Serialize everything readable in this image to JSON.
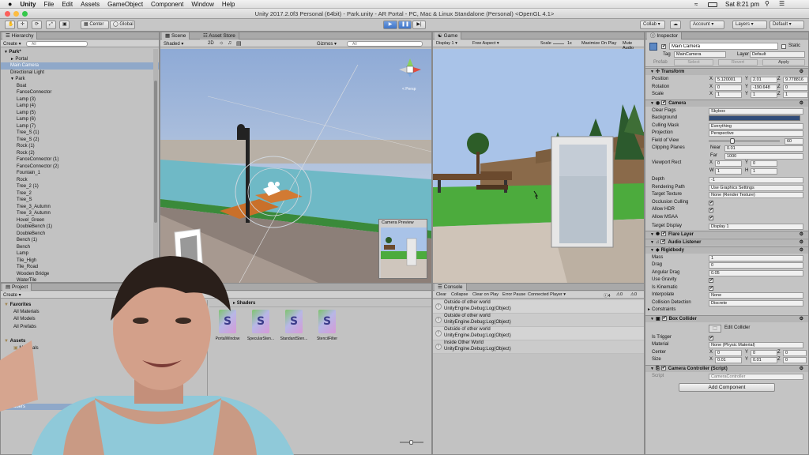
{
  "menubar": {
    "apple": "",
    "app": "Unity",
    "items": [
      "File",
      "Edit",
      "Assets",
      "GameObject",
      "Component",
      "Window",
      "Help"
    ],
    "clock": "Sat 8:21 pm"
  },
  "window": {
    "title": "Unity 2017.2.0f3 Personal (64bit) - Park.unity - AR Portal - PC, Mac & Linux Standalone (Personal) <OpenGL 4.1>"
  },
  "toolbar": {
    "pivot": "Center",
    "space": "Global",
    "collab": "Collab",
    "account": "Account",
    "layers": "Layers",
    "layout": "Default"
  },
  "hierarchy": {
    "tab": "Hierarchy",
    "create": "Create",
    "search_placeholder": "All",
    "rows": [
      {
        "label": "Park*",
        "indent": 0,
        "arrow": "▼",
        "bold": true
      },
      {
        "label": "Portal",
        "indent": 1,
        "arrow": "►"
      },
      {
        "label": "Main Camera",
        "indent": 1,
        "selected": true
      },
      {
        "label": "Directional Light",
        "indent": 1
      },
      {
        "label": "Park",
        "indent": 1,
        "arrow": "▼"
      },
      {
        "label": "Boat",
        "indent": 2
      },
      {
        "label": "FanceConnector",
        "indent": 2
      },
      {
        "label": "Lamp (3)",
        "indent": 2
      },
      {
        "label": "Lamp (4)",
        "indent": 2
      },
      {
        "label": "Lamp (5)",
        "indent": 2
      },
      {
        "label": "Lamp (6)",
        "indent": 2
      },
      {
        "label": "Lamp (7)",
        "indent": 2
      },
      {
        "label": "Tree_S (1)",
        "indent": 2
      },
      {
        "label": "Tree_S (2)",
        "indent": 2
      },
      {
        "label": "Rock (1)",
        "indent": 2
      },
      {
        "label": "Rock (2)",
        "indent": 2
      },
      {
        "label": "FanceConnector (1)",
        "indent": 2
      },
      {
        "label": "FanceConnector (2)",
        "indent": 2
      },
      {
        "label": "Fountain_1",
        "indent": 2
      },
      {
        "label": "Rock",
        "indent": 2
      },
      {
        "label": "Tree_2 (1)",
        "indent": 2
      },
      {
        "label": "Tree_2",
        "indent": 2
      },
      {
        "label": "Tree_S",
        "indent": 2
      },
      {
        "label": "Tree_3_Autumn",
        "indent": 2
      },
      {
        "label": "Tree_3_Autumn",
        "indent": 2
      },
      {
        "label": "Hovel_Green",
        "indent": 2
      },
      {
        "label": "DoubleBench (1)",
        "indent": 2
      },
      {
        "label": "DoubleBench",
        "indent": 2
      },
      {
        "label": "Bench (1)",
        "indent": 2
      },
      {
        "label": "Bench",
        "indent": 2
      },
      {
        "label": "Lamp",
        "indent": 2
      },
      {
        "label": "Tile_High",
        "indent": 2
      },
      {
        "label": "Tile_Road",
        "indent": 2
      },
      {
        "label": "Wooden Bridge",
        "indent": 2
      },
      {
        "label": "WaterTile",
        "indent": 2
      }
    ]
  },
  "scene": {
    "tabs": [
      "Scene",
      "Asset Store"
    ],
    "shading": "Shaded",
    "mode2d": "2D",
    "gizmos": "Gizmos",
    "search": "All",
    "persp": "< Persp",
    "preview_title": "Camera Preview"
  },
  "game": {
    "tab": "Game",
    "display": "Display 1",
    "aspect": "Free Aspect",
    "scale_label": "Scale",
    "scale_value": "1x",
    "maximize": "Maximize On Play",
    "mute": "Mute Audio"
  },
  "project": {
    "tab": "Project",
    "create": "Create",
    "breadcrumb": "Shaders",
    "tree": [
      {
        "label": "Favorites",
        "indent": 0,
        "folder": true,
        "bold": true
      },
      {
        "label": "All Materials",
        "indent": 1
      },
      {
        "label": "All Models",
        "indent": 1
      },
      {
        "label": "All Prefabs",
        "indent": 1
      },
      {
        "label": "",
        "indent": 0
      },
      {
        "label": "Assets",
        "indent": 0,
        "folder": true,
        "bold": true
      },
      {
        "label": "Materials",
        "indent": 1,
        "folder": true
      },
      {
        "label": "Materials",
        "indent": 1
      },
      {
        "label": "odels",
        "indent": 1
      },
      {
        "label": "efabs",
        "indent": 1
      },
      {
        "label": "xtures",
        "indent": 1
      },
      {
        "label": "nts",
        "indent": 1
      },
      {
        "label": "es",
        "indent": 1
      },
      {
        "label": "ts",
        "indent": 1
      },
      {
        "label": "aders",
        "indent": 1,
        "selected": true
      }
    ],
    "files": [
      "PortalWindow",
      "SpecularSten...",
      "StandardSten...",
      "StencilFilter"
    ]
  },
  "console": {
    "tab": "Console",
    "buttons": [
      "Clear",
      "Collapse",
      "Clear on Play",
      "Error Pause",
      "Connected Player ▾"
    ],
    "count_log": "4",
    "count_warn": "0",
    "count_err": "0",
    "entries": [
      {
        "line1": "Outside of other world",
        "line2": "UnityEngine.Debug:Log(Object)"
      },
      {
        "line1": "Outside of other world",
        "line2": "UnityEngine.Debug:Log(Object)"
      },
      {
        "line1": "Outside of other world",
        "line2": "UnityEngine.Debug:Log(Object)"
      },
      {
        "line1": "Inside Other World",
        "line2": "UnityEngine.Debug:Log(Object)"
      }
    ]
  },
  "inspector": {
    "tab": "Inspector",
    "object_name": "Main Camera",
    "static": "Static",
    "tag_label": "Tag",
    "tag_value": "MainCamera",
    "layer_label": "Layer",
    "layer_value": "Default",
    "prefab_label": "Prefab",
    "select": "Select",
    "revert": "Revert",
    "apply": "Apply",
    "transform": {
      "title": "Transform",
      "position": {
        "label": "Position",
        "x": "5.120001",
        "y": "2.01",
        "z": "9.778816"
      },
      "rotation": {
        "label": "Rotation",
        "x": "0",
        "y": "-190.648",
        "z": "0"
      },
      "scale": {
        "label": "Scale",
        "x": "1",
        "y": "1",
        "z": "1"
      }
    },
    "camera": {
      "title": "Camera",
      "clear_flags_label": "Clear Flags",
      "clear_flags": "Skybox",
      "background_label": "Background",
      "culling_label": "Culling Mask",
      "culling": "Everything",
      "projection_label": "Projection",
      "projection": "Perspective",
      "fov_label": "Field of View",
      "fov": "60",
      "fov_fraction": 0.33,
      "clipping_label": "Clipping Planes",
      "near_label": "Near",
      "near": "0.01",
      "far_label": "Far",
      "far": "1000",
      "viewport_label": "Viewport Rect",
      "vx": "0",
      "vy": "0",
      "vw": "1",
      "vh": "1",
      "depth_label": "Depth",
      "depth": "-1",
      "rendering_label": "Rendering Path",
      "rendering": "Use Graphics Settings",
      "target_tex_label": "Target Texture",
      "target_tex": "None (Render Texture)",
      "occlusion_label": "Occlusion Culling",
      "hdr_label": "Allow HDR",
      "msaa_label": "Allow MSAA",
      "target_display_label": "Target Display",
      "target_display": "Display 1"
    },
    "flare_layer": "Flare Layer",
    "audio_listener": "Audio Listener",
    "rigidbody": {
      "title": "Rigidbody",
      "mass_label": "Mass",
      "mass": "1",
      "drag_label": "Drag",
      "drag": "0",
      "angular_label": "Angular Drag",
      "angular": "0.05",
      "gravity_label": "Use Gravity",
      "kinematic_label": "Is Kinematic",
      "interpolate_label": "Interpolate",
      "interpolate": "None",
      "collision_label": "Collision Detection",
      "collision": "Discrete",
      "constraints_label": "Constraints"
    },
    "box_collider": {
      "title": "Box Collider",
      "edit": "Edit Collider",
      "trigger_label": "Is Trigger",
      "material_label": "Material",
      "material": "None (Physic Material)",
      "center_label": "Center",
      "cx": "0",
      "cy": "0",
      "cz": "0",
      "size_label": "Size",
      "sx": "0.01",
      "sy": "0.01",
      "sz": "0"
    },
    "script": {
      "title": "Camera Controller (Script)",
      "label": "Script",
      "value": "CameraController"
    },
    "add_component": "Add Component"
  },
  "colors": {
    "sky": "#a9c3e8",
    "water": "#6fb9c6",
    "grass": "#4cab3d",
    "wood": "#c9702a",
    "selection": "#8fa8c9",
    "background_swatch": "#314d79"
  }
}
